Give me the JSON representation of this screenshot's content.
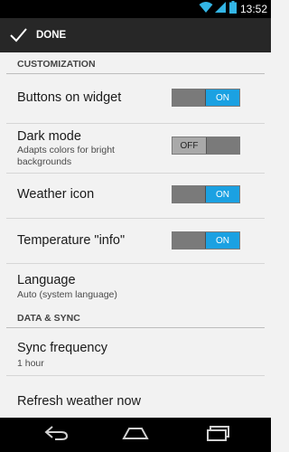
{
  "status_bar": {
    "time": "13:52"
  },
  "action_bar": {
    "done_label": "DONE"
  },
  "sections": {
    "customization": "CUSTOMIZATION",
    "data_sync": "DATA & SYNC"
  },
  "settings": {
    "buttons_on_widget": {
      "title": "Buttons on widget",
      "toggle": "ON"
    },
    "dark_mode": {
      "title": "Dark mode",
      "summary": "Adapts colors for bright backgrounds",
      "toggle": "OFF"
    },
    "weather_icon": {
      "title": "Weather icon",
      "toggle": "ON"
    },
    "temperature_info": {
      "title": "Temperature \"info\"",
      "toggle": "ON"
    },
    "language": {
      "title": "Language",
      "summary": "Auto (system language)"
    },
    "sync_frequency": {
      "title": "Sync frequency",
      "summary": "1 hour"
    },
    "refresh_weather": {
      "title": "Refresh weather now"
    }
  },
  "colors": {
    "accent": "#1ba1e2",
    "action_bar": "#272727",
    "background": "#f2f2f2"
  },
  "icons": {
    "wifi": "wifi-icon",
    "signal": "signal-icon",
    "battery": "battery-icon",
    "done": "checkmark-icon",
    "back": "back-icon",
    "home": "home-icon",
    "recents": "recents-icon"
  }
}
